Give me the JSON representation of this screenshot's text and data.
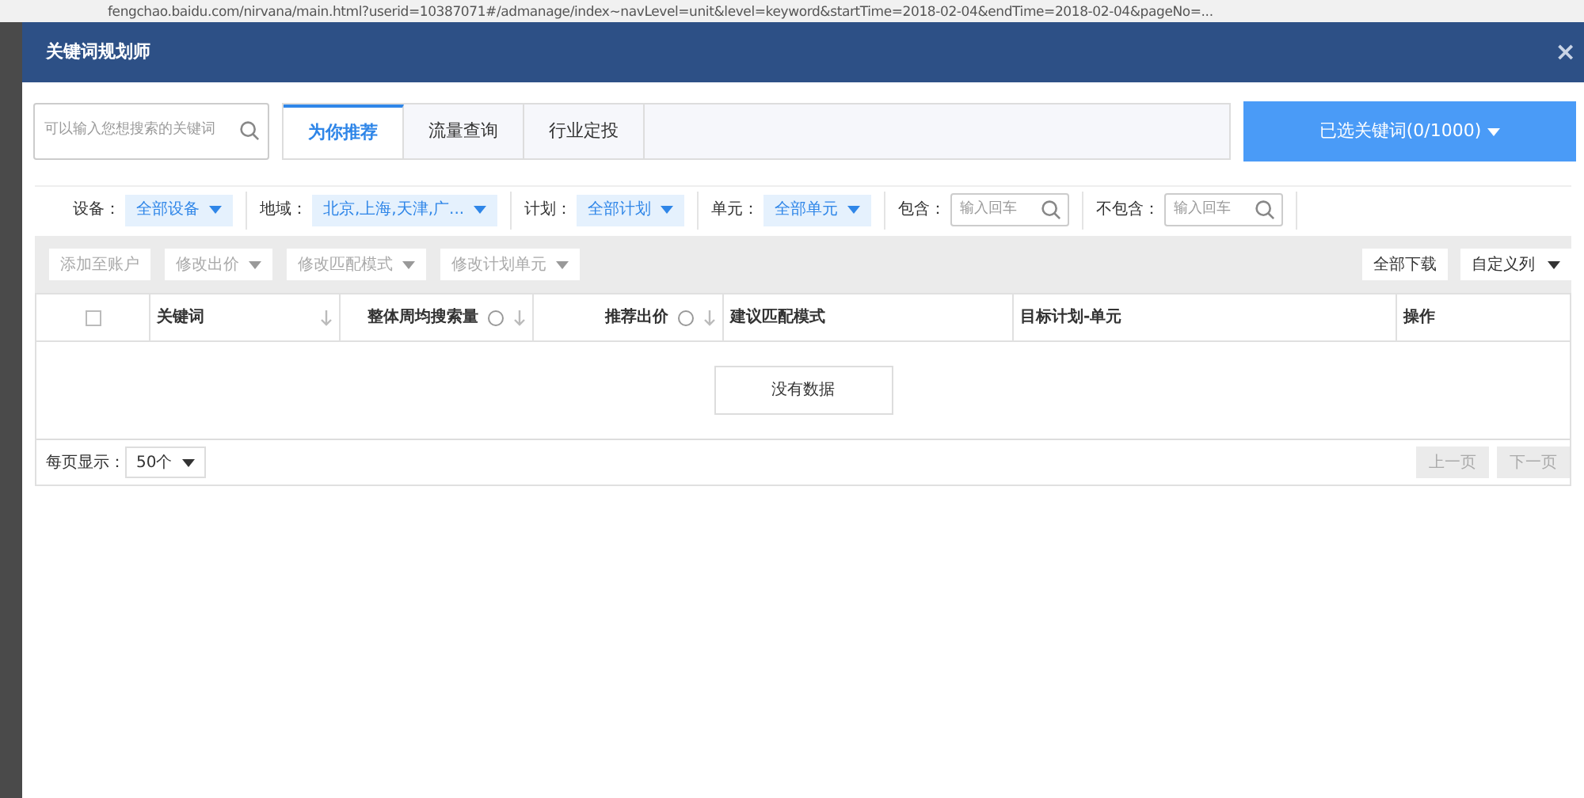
{
  "browser": {
    "url": "fengchao.baidu.com/nirvana/main.html?userid=10387071#/admanage/index~navLevel=unit&level=keyword&startTime=2018-02-04&endTime=2018-02-04&pageNo=..."
  },
  "dialog": {
    "title": "关键词规划师",
    "close": "×"
  },
  "search": {
    "placeholder": "可以输入您想搜索的关键词"
  },
  "tabs": [
    {
      "label": "为你推荐",
      "selected": true
    },
    {
      "label": "流量查询",
      "selected": false
    },
    {
      "label": "行业定投",
      "selected": false
    }
  ],
  "selected_keywords_button": "已选关键词(0/1000)",
  "filters": [
    {
      "kind": "select",
      "label": "设备：",
      "value": "全部设备"
    },
    {
      "kind": "select",
      "label": "地域：",
      "value": "北京,上海,天津,广..."
    },
    {
      "kind": "select",
      "label": "计划：",
      "value": "全部计划"
    },
    {
      "kind": "select",
      "label": "单元：",
      "value": "全部单元"
    },
    {
      "kind": "search",
      "label": "包含：",
      "placeholder": "输入回车"
    },
    {
      "kind": "search",
      "label": "不包含：",
      "placeholder": "输入回车"
    }
  ],
  "actions": [
    {
      "label": "添加至账户",
      "dropdown": false,
      "disabled": true
    },
    {
      "label": "修改出价",
      "dropdown": true,
      "disabled": true
    },
    {
      "label": "修改匹配模式",
      "dropdown": true,
      "disabled": true
    },
    {
      "label": "修改计划单元",
      "dropdown": true,
      "disabled": true
    }
  ],
  "right_actions": [
    {
      "label": "全部下载",
      "dropdown": false
    },
    {
      "label": "自定义列",
      "dropdown": true
    }
  ],
  "table": {
    "select_all_checked": false,
    "columns": [
      {
        "label": "关键词",
        "sortable": true,
        "help": false
      },
      {
        "label": "整体周均搜索量",
        "sortable": true,
        "help": true
      },
      {
        "label": "推荐出价",
        "sortable": true,
        "help": true
      },
      {
        "label": "建议匹配模式",
        "sortable": false,
        "help": false
      },
      {
        "label": "目标计划-单元",
        "sortable": false,
        "help": false
      },
      {
        "label": "操作",
        "sortable": false,
        "help": false
      }
    ],
    "empty_message": "没有数据"
  },
  "footer": {
    "page_size_label": "每页显示：",
    "page_size": "50个",
    "prev": {
      "label": "上一页",
      "disabled": true
    },
    "next": {
      "label": "下一页",
      "disabled": true
    }
  }
}
